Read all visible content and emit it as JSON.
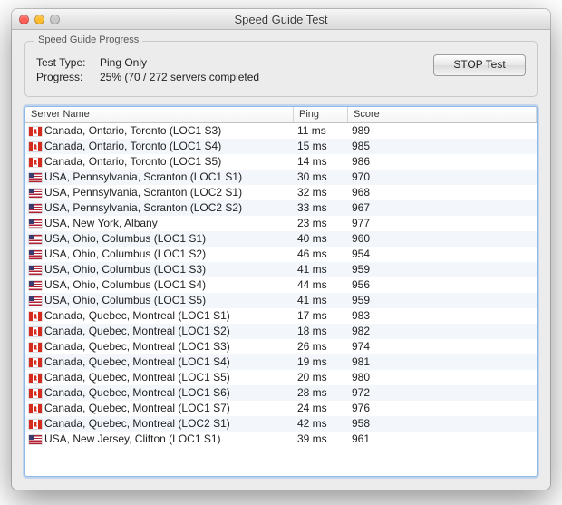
{
  "window": {
    "title": "Speed Guide Test"
  },
  "group": {
    "label": "Speed Guide Progress",
    "testTypeLabel": "Test Type:",
    "testTypeValue": "Ping Only",
    "progressLabel": "Progress:",
    "progressValue": "25% (70 / 272 servers completed",
    "stopButton": "STOP Test"
  },
  "columns": {
    "name": "Server Name",
    "ping": "Ping",
    "score": "Score"
  },
  "rows": [
    {
      "flag": "ca",
      "name": "Canada, Ontario, Toronto (LOC1 S3)",
      "ping": "11 ms",
      "score": "989"
    },
    {
      "flag": "ca",
      "name": "Canada, Ontario, Toronto (LOC1 S4)",
      "ping": "15 ms",
      "score": "985"
    },
    {
      "flag": "ca",
      "name": "Canada, Ontario, Toronto (LOC1 S5)",
      "ping": "14 ms",
      "score": "986"
    },
    {
      "flag": "us",
      "name": "USA, Pennsylvania, Scranton (LOC1 S1)",
      "ping": "30 ms",
      "score": "970"
    },
    {
      "flag": "us",
      "name": "USA, Pennsylvania, Scranton (LOC2 S1)",
      "ping": "32 ms",
      "score": "968"
    },
    {
      "flag": "us",
      "name": "USA, Pennsylvania, Scranton (LOC2 S2)",
      "ping": "33 ms",
      "score": "967"
    },
    {
      "flag": "us",
      "name": "USA, New York, Albany",
      "ping": "23 ms",
      "score": "977"
    },
    {
      "flag": "us",
      "name": "USA, Ohio, Columbus (LOC1 S1)",
      "ping": "40 ms",
      "score": "960"
    },
    {
      "flag": "us",
      "name": "USA, Ohio, Columbus (LOC1 S2)",
      "ping": "46 ms",
      "score": "954"
    },
    {
      "flag": "us",
      "name": "USA, Ohio, Columbus (LOC1 S3)",
      "ping": "41 ms",
      "score": "959"
    },
    {
      "flag": "us",
      "name": "USA, Ohio, Columbus (LOC1 S4)",
      "ping": "44 ms",
      "score": "956"
    },
    {
      "flag": "us",
      "name": "USA, Ohio, Columbus (LOC1 S5)",
      "ping": "41 ms",
      "score": "959"
    },
    {
      "flag": "ca",
      "name": "Canada, Quebec, Montreal (LOC1 S1)",
      "ping": "17 ms",
      "score": "983"
    },
    {
      "flag": "ca",
      "name": "Canada, Quebec, Montreal (LOC1 S2)",
      "ping": "18 ms",
      "score": "982"
    },
    {
      "flag": "ca",
      "name": "Canada, Quebec, Montreal (LOC1 S3)",
      "ping": "26 ms",
      "score": "974"
    },
    {
      "flag": "ca",
      "name": "Canada, Quebec, Montreal (LOC1 S4)",
      "ping": "19 ms",
      "score": "981"
    },
    {
      "flag": "ca",
      "name": "Canada, Quebec, Montreal (LOC1 S5)",
      "ping": "20 ms",
      "score": "980"
    },
    {
      "flag": "ca",
      "name": "Canada, Quebec, Montreal (LOC1 S6)",
      "ping": "28 ms",
      "score": "972"
    },
    {
      "flag": "ca",
      "name": "Canada, Quebec, Montreal (LOC1 S7)",
      "ping": "24 ms",
      "score": "976"
    },
    {
      "flag": "ca",
      "name": "Canada, Quebec, Montreal (LOC2 S1)",
      "ping": "42 ms",
      "score": "958"
    },
    {
      "flag": "us",
      "name": "USA, New Jersey, Clifton (LOC1 S1)",
      "ping": "39 ms",
      "score": "961"
    }
  ]
}
